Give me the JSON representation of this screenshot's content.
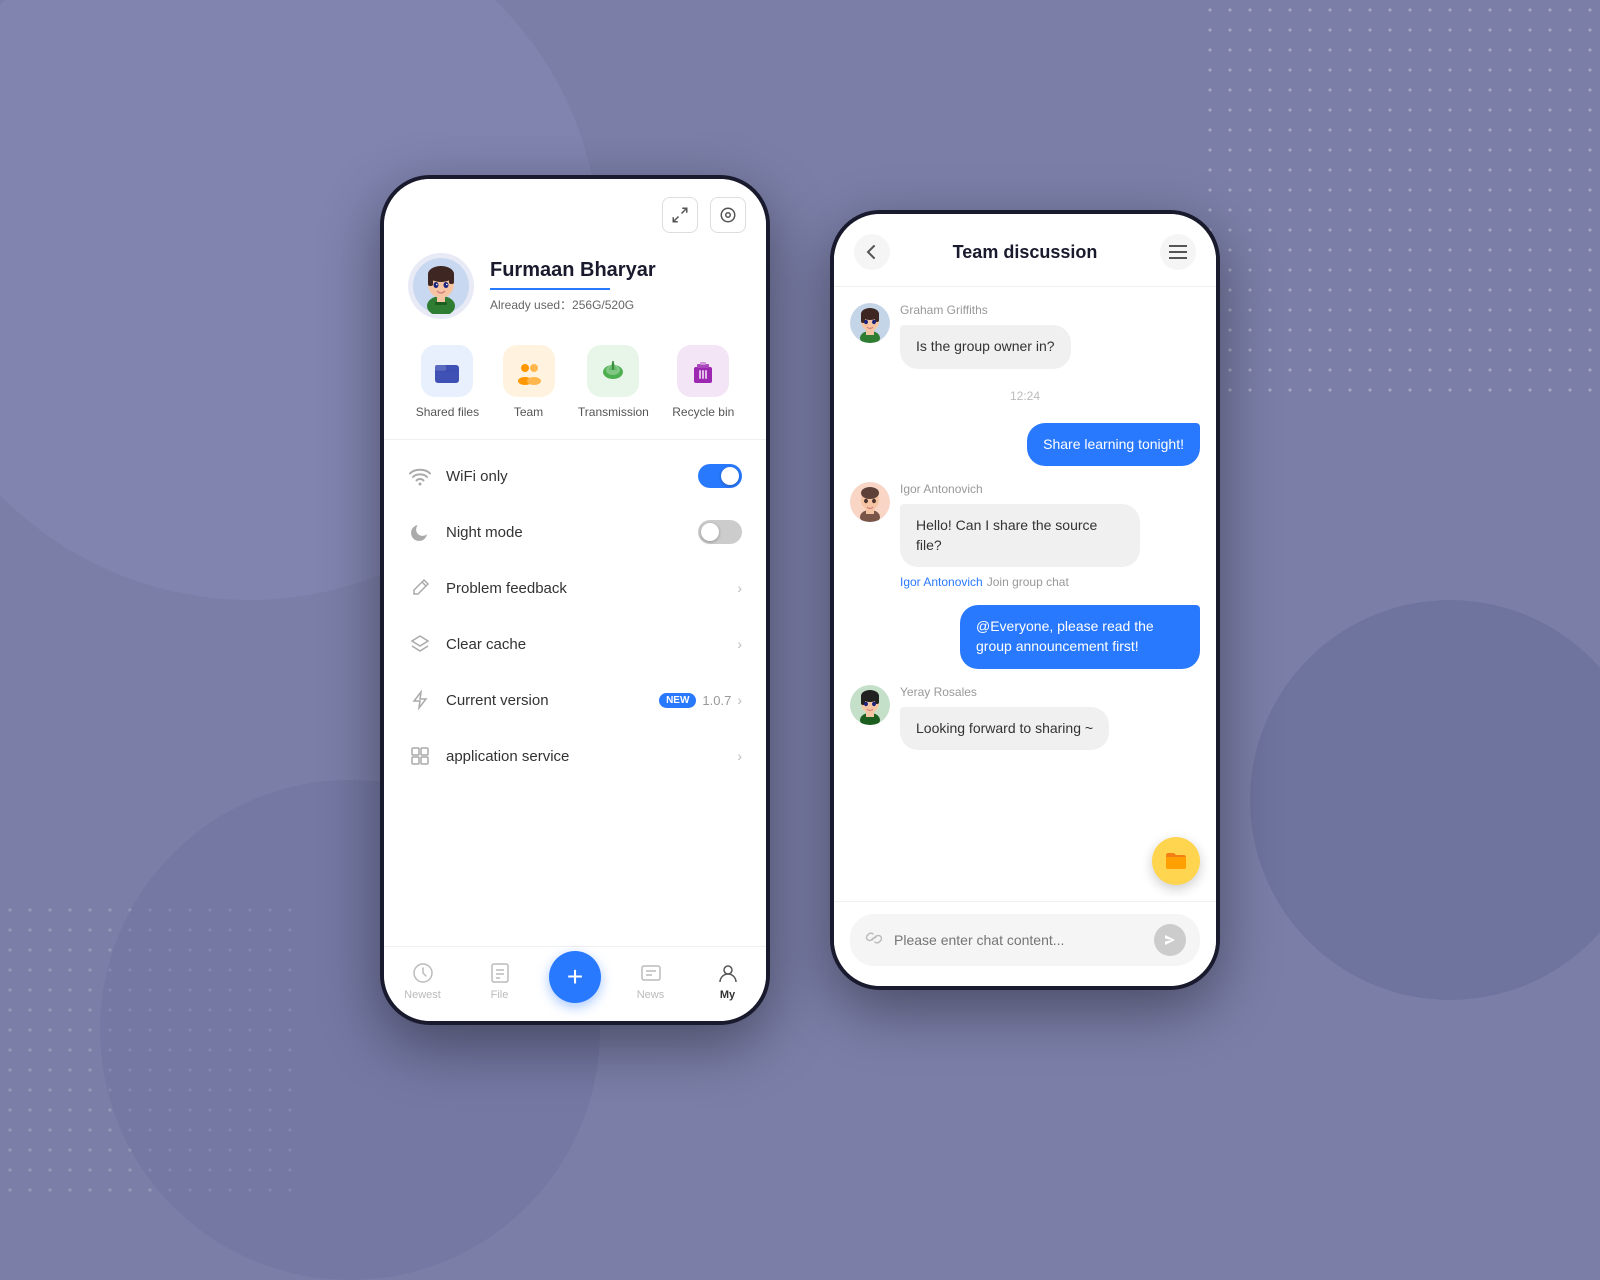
{
  "background": {
    "color": "#7b7fa8"
  },
  "left_phone": {
    "toolbar": {
      "expand_icon": "⛶",
      "settings_icon": "◎"
    },
    "profile": {
      "name": "Furmaan Bharyar",
      "storage_label": "Already used：",
      "storage_used": "256G/520G"
    },
    "quick_actions": [
      {
        "label": "Shared files",
        "icon": "📁",
        "color_class": "action-icon-blue"
      },
      {
        "label": "Team",
        "icon": "👥",
        "color_class": "action-icon-orange"
      },
      {
        "label": "Transmission",
        "icon": "☁️",
        "color_class": "action-icon-green"
      },
      {
        "label": "Recycle bin",
        "icon": "🗑️",
        "color_class": "action-icon-purple"
      }
    ],
    "menu_items": [
      {
        "id": "wifi",
        "label": "WiFi only",
        "type": "toggle",
        "toggle_on": true,
        "icon": "wifi"
      },
      {
        "id": "night",
        "label": "Night mode",
        "type": "toggle",
        "toggle_on": false,
        "icon": "moon"
      },
      {
        "id": "feedback",
        "label": "Problem feedback",
        "type": "arrow",
        "icon": "pencil"
      },
      {
        "id": "cache",
        "label": "Clear cache",
        "type": "arrow",
        "icon": "layers"
      },
      {
        "id": "version",
        "label": "Current version",
        "type": "version",
        "badge": "NEW",
        "version": "1.0.7",
        "icon": "bolt"
      },
      {
        "id": "service",
        "label": "application service",
        "type": "arrow",
        "icon": "grid"
      }
    ],
    "bottom_nav": [
      {
        "id": "newest",
        "label": "Newest",
        "icon": "🕐"
      },
      {
        "id": "file",
        "label": "File",
        "icon": "📂"
      },
      {
        "id": "add",
        "label": "+",
        "icon": "+"
      },
      {
        "id": "news",
        "label": "News",
        "icon": "💬"
      },
      {
        "id": "my",
        "label": "My",
        "icon": "👤"
      }
    ]
  },
  "right_phone": {
    "header": {
      "title": "Team discussion",
      "back_label": "‹",
      "menu_label": "☰"
    },
    "messages": [
      {
        "id": "msg1",
        "sender": "Graham Griffiths",
        "direction": "incoming",
        "text": "Is the group owner in?"
      },
      {
        "id": "msg2",
        "direction": "time",
        "text": "12:24"
      },
      {
        "id": "msg3",
        "sender": "",
        "direction": "outgoing",
        "text": "Share learning tonight!"
      },
      {
        "id": "msg4",
        "sender": "Igor Antonovich",
        "direction": "incoming",
        "text": "Hello! Can I share the source file?",
        "join_name": "Igor Antonovich",
        "join_text": "Join group chat"
      },
      {
        "id": "msg5",
        "sender": "",
        "direction": "outgoing",
        "text": "@Everyone, please read the group announcement first!"
      },
      {
        "id": "msg6",
        "sender": "Yeray Rosales",
        "direction": "incoming",
        "text": "Looking forward to sharing ~"
      }
    ],
    "input": {
      "placeholder": "Please enter chat content...",
      "send_icon": "➤",
      "link_icon": "🔗"
    },
    "float_button": "📁"
  }
}
